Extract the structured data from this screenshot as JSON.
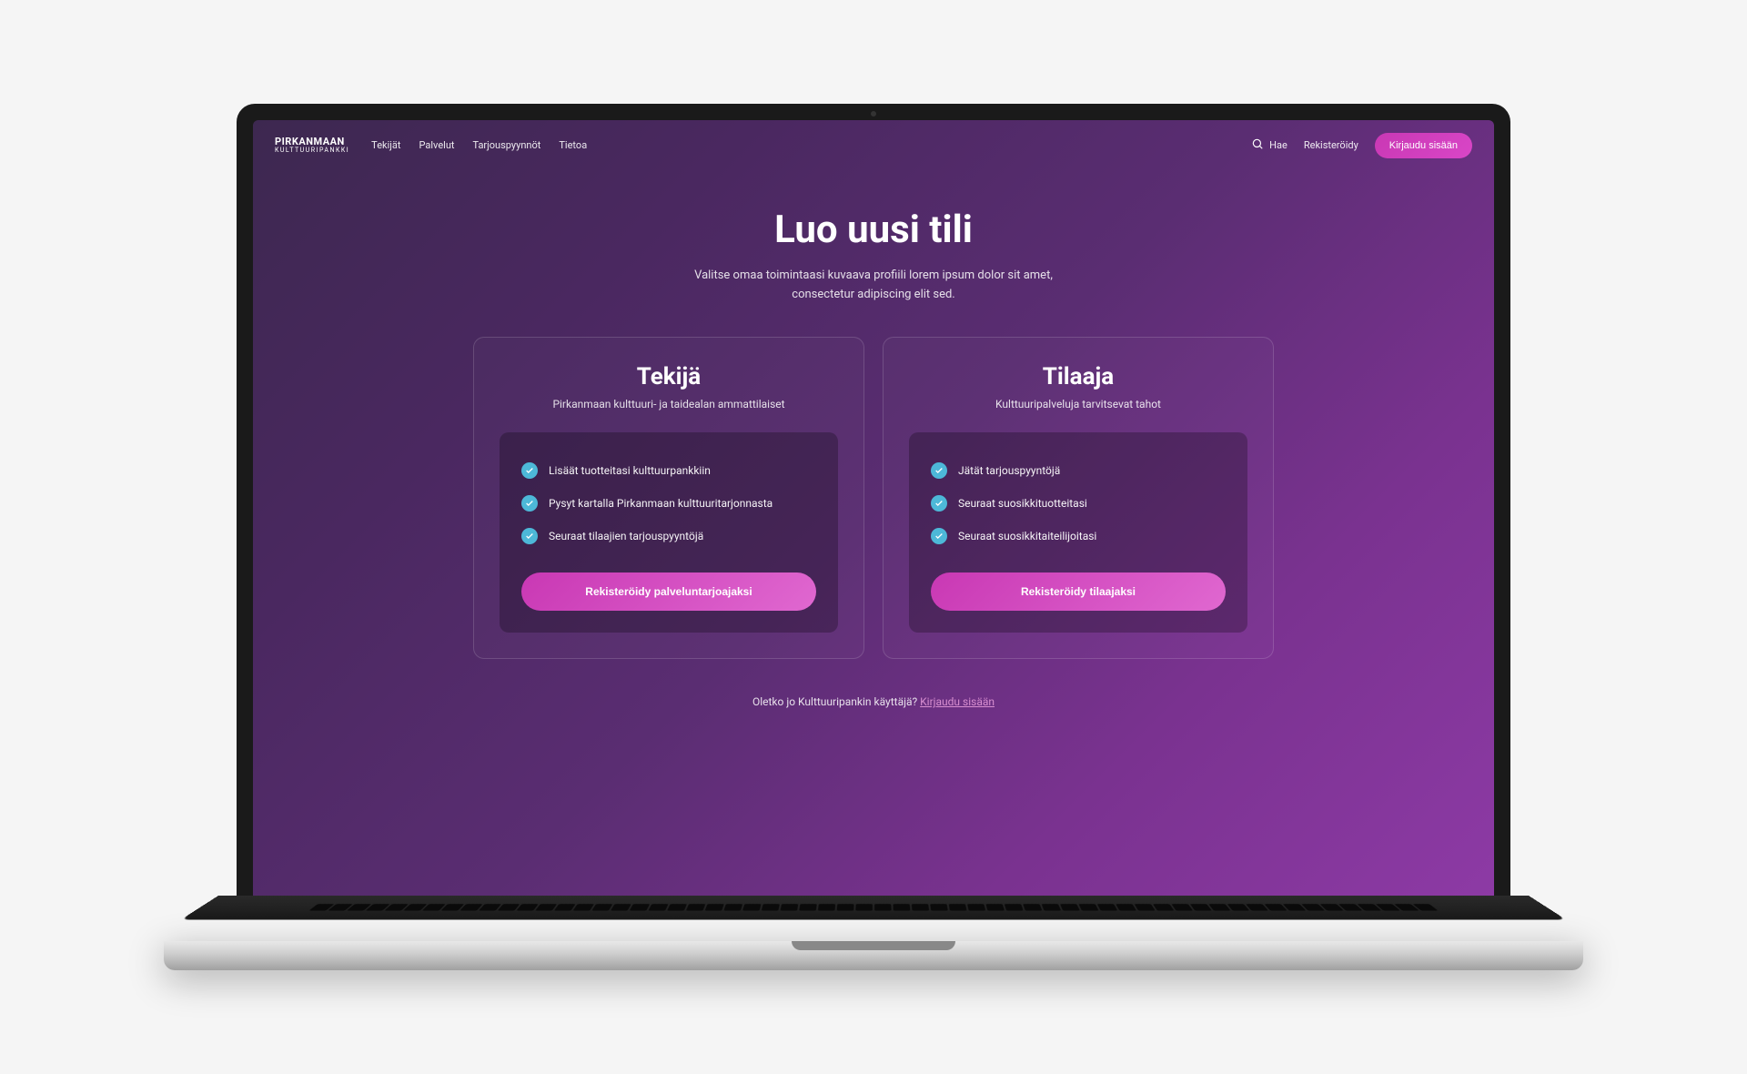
{
  "header": {
    "logo": {
      "main": "PIRKANMAAN",
      "sub": "KULTTUURIPANKKI"
    },
    "nav": [
      "Tekijät",
      "Palvelut",
      "Tarjouspyynnöt",
      "Tietoa"
    ],
    "search_label": "Hae",
    "register_label": "Rekisteröidy",
    "login_label": "Kirjaudu sisään"
  },
  "main": {
    "title": "Luo uusi tili",
    "subtitle": "Valitse omaa toimintaasi kuvaava profiili lorem ipsum dolor sit amet, consectetur adipiscing elit sed.",
    "cards": [
      {
        "title": "Tekijä",
        "subtitle": "Pirkanmaan kulttuuri- ja taidealan ammattilaiset",
        "features": [
          "Lisäät tuotteitasi kulttuurpankkiin",
          "Pysyt kartalla Pirkanmaan kulttuuritarjonnasta",
          "Seuraat tilaajien tarjouspyyntöjä"
        ],
        "button": "Rekisteröidy palveluntarjoajaksi"
      },
      {
        "title": "Tilaaja",
        "subtitle": "Kulttuuripalveluja tarvitsevat tahot",
        "features": [
          "Jätät tarjouspyyntöjä",
          "Seuraat suosikkituotteitasi",
          "Seuraat suosikkitaiteilijoitasi"
        ],
        "button": "Rekisteröidy tilaajaksi"
      }
    ],
    "footer_text": "Oletko jo Kulttuuripankin käyttäjä? ",
    "footer_link": "Kirjaudu sisään"
  }
}
